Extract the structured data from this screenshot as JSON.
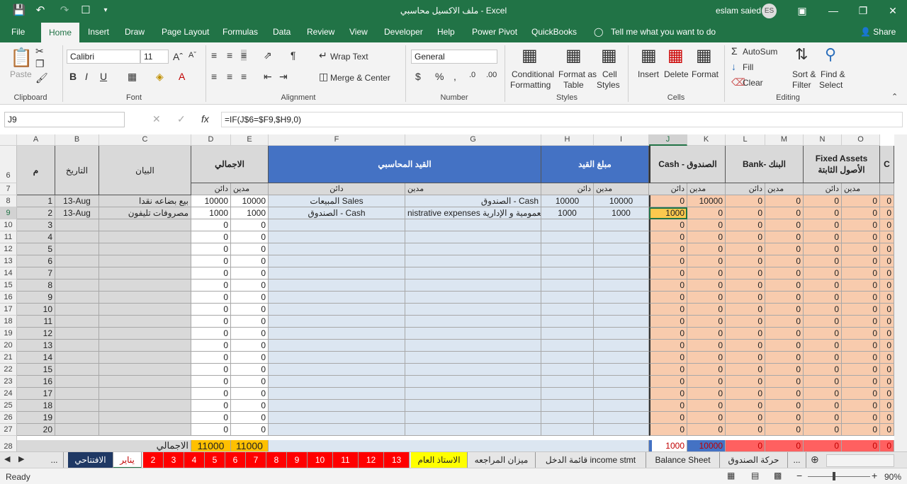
{
  "window": {
    "title": "ملف الاكسيل محاسبي  -  Excel",
    "user": "eslam saied",
    "avatar_initials": "ES"
  },
  "quick_access": [
    "save-icon",
    "undo-icon",
    "redo-icon",
    "touch-mode-icon",
    "customize-icon"
  ],
  "tabs": [
    "File",
    "Home",
    "Insert",
    "Draw",
    "Page Layout",
    "Formulas",
    "Data",
    "Review",
    "View",
    "Developer",
    "Help",
    "Power Pivot",
    "QuickBooks"
  ],
  "tell_me": "Tell me what you want to do",
  "share": "Share",
  "ribbon": {
    "clipboard": {
      "paste": "Paste",
      "group": "Clipboard"
    },
    "font": {
      "name": "Calibri",
      "size": "11",
      "group": "Font"
    },
    "alignment": {
      "wrap": "Wrap Text",
      "merge": "Merge & Center",
      "group": "Alignment"
    },
    "number": {
      "format": "General",
      "group": "Number"
    },
    "styles": {
      "cond1": "Conditional",
      "cond2": "Formatting",
      "fmt1": "Format as",
      "fmt2": "Table",
      "cs1": "Cell",
      "cs2": "Styles",
      "group": "Styles"
    },
    "cells": {
      "insert": "Insert",
      "delete": "Delete",
      "format": "Format",
      "group": "Cells"
    },
    "editing": {
      "autosum": "AutoSum",
      "fill": "Fill",
      "clear": "Clear",
      "sort1": "Sort &",
      "sort2": "Filter",
      "find1": "Find &",
      "find2": "Select",
      "group": "Editing"
    }
  },
  "formula_bar": {
    "name_box": "J9",
    "formula": "=IF(J$6=$F9,$H9,0)"
  },
  "columns": [
    "A",
    "B",
    "C",
    "D",
    "E",
    "F",
    "G",
    "H",
    "I",
    "J",
    "K",
    "L",
    "M",
    "N",
    "O"
  ],
  "headers": {
    "a": "م",
    "b": "التاريخ",
    "c": "البيان",
    "total": "الاجمالي",
    "entry": "القيد المحاسبي",
    "amount": "مبلغ القيد",
    "cash": "Cash - الصندوق",
    "bank": "Bank- البنك",
    "fixed1": "Fixed Assets",
    "fixed2": "الأصول الثابتة",
    "credit": "دائن",
    "debit": "مدين"
  },
  "rows": [
    {
      "r": "8",
      "a": "1",
      "b": "13-Aug",
      "c": "بيع بضاعه نقدا",
      "d": "10000",
      "e": "10000",
      "f": "المبيعات Sales",
      "g": "الصندوق - Cash",
      "h": "10000",
      "i": "10000",
      "j": "0",
      "k": "10000"
    },
    {
      "r": "9",
      "a": "2",
      "b": "13-Aug",
      "c": "مصروفات تليفون",
      "d": "1000",
      "e": "1000",
      "f": "الصندوق - Cash",
      "g": "nistrative expenses المصروفات العمومية و الإدارية",
      "h": "1000",
      "i": "1000",
      "j": "1000",
      "k": "0"
    },
    {
      "r": "10",
      "a": "3",
      "d": "0",
      "e": "0",
      "j": "0",
      "k": "0"
    },
    {
      "r": "11",
      "a": "4",
      "d": "0",
      "e": "0",
      "j": "0",
      "k": "0"
    },
    {
      "r": "12",
      "a": "5",
      "d": "0",
      "e": "0",
      "j": "0",
      "k": "0"
    },
    {
      "r": "13",
      "a": "6",
      "d": "0",
      "e": "0",
      "j": "0",
      "k": "0"
    },
    {
      "r": "14",
      "a": "7",
      "d": "0",
      "e": "0",
      "j": "0",
      "k": "0"
    },
    {
      "r": "15",
      "a": "8",
      "d": "0",
      "e": "0",
      "j": "0",
      "k": "0"
    },
    {
      "r": "16",
      "a": "9",
      "d": "0",
      "e": "0",
      "j": "0",
      "k": "0"
    },
    {
      "r": "17",
      "a": "10",
      "d": "0",
      "e": "0",
      "j": "0",
      "k": "0"
    },
    {
      "r": "18",
      "a": "11",
      "d": "0",
      "e": "0",
      "j": "0",
      "k": "0"
    },
    {
      "r": "19",
      "a": "12",
      "d": "0",
      "e": "0",
      "j": "0",
      "k": "0"
    },
    {
      "r": "20",
      "a": "13",
      "d": "0",
      "e": "0",
      "j": "0",
      "k": "0"
    },
    {
      "r": "21",
      "a": "14",
      "d": "0",
      "e": "0",
      "j": "0",
      "k": "0"
    },
    {
      "r": "22",
      "a": "15",
      "d": "0",
      "e": "0",
      "j": "0",
      "k": "0"
    },
    {
      "r": "23",
      "a": "16",
      "d": "0",
      "e": "0",
      "j": "0",
      "k": "0"
    },
    {
      "r": "24",
      "a": "17",
      "d": "0",
      "e": "0",
      "j": "0",
      "k": "0"
    },
    {
      "r": "25",
      "a": "18",
      "d": "0",
      "e": "0",
      "j": "0",
      "k": "0"
    },
    {
      "r": "26",
      "a": "19",
      "d": "0",
      "e": "0",
      "j": "0",
      "k": "0"
    },
    {
      "r": "27",
      "a": "20",
      "d": "0",
      "e": "0",
      "j": "0",
      "k": "0"
    }
  ],
  "other_zero": "0",
  "totals": {
    "label": "الاجمالي",
    "d": "11000",
    "e": "11000",
    "j": "1000",
    "k": "10000",
    "rest": "0"
  },
  "sheet_tabs": [
    "...",
    "الافتتاحي",
    "يناير",
    "2",
    "3",
    "4",
    "5",
    "6",
    "7",
    "8",
    "9",
    "10",
    "11",
    "12",
    "13",
    "الاستاذ العام",
    "ميزان المراجعه",
    "قائمة الدخل income stmt",
    "Balance Sheet",
    "حركة الصندوق",
    "..."
  ],
  "status": {
    "ready": "Ready",
    "zoom": "90%"
  },
  "colors": {
    "excel_green": "#217346",
    "header_blue": "#4472c4",
    "cell_blue": "#dce6f1",
    "orange": "#f8cbad",
    "yellow": "#ffc000"
  }
}
